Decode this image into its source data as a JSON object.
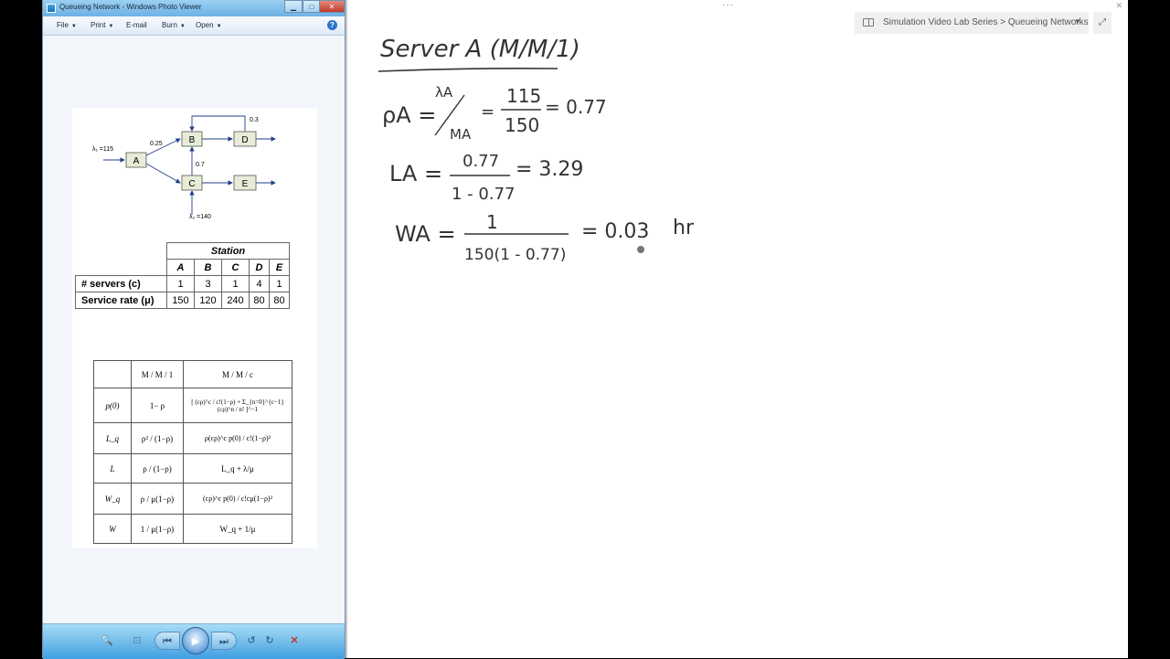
{
  "photo_viewer": {
    "title": "Queueing Network - Windows Photo Viewer",
    "window_controls": {
      "minimize": "▁",
      "maximize": "□",
      "close": "✕"
    },
    "menu": [
      {
        "label": "File"
      },
      {
        "label": "Print"
      },
      {
        "label": "E-mail"
      },
      {
        "label": "Burn"
      },
      {
        "label": "Open"
      }
    ],
    "help": "?",
    "diagram": {
      "nodes": [
        "A",
        "B",
        "C",
        "D",
        "E"
      ],
      "lambda1": "λ₁ =115",
      "lambda2": "λ₂ =140",
      "p_ab": "0.25",
      "p_cb": "0.7",
      "p_db": "0.3"
    },
    "station_table": {
      "title": "Station",
      "stations": [
        "A",
        "B",
        "C",
        "D",
        "E"
      ],
      "rows": [
        {
          "label": "# servers (c)",
          "values": [
            "1",
            "3",
            "1",
            "4",
            "1"
          ]
        },
        {
          "label": "Service rate (μ)",
          "values": [
            "150",
            "120",
            "240",
            "80",
            "80"
          ]
        }
      ]
    },
    "formula_table": {
      "headers": [
        "M / M / 1",
        "M / M / c"
      ],
      "rows": [
        {
          "label": "p(0)",
          "mm1": "1− ρ",
          "mmc": "[ (cρ)^c / c!(1−ρ) + Σ_{n=0}^{c−1} (cρ)^n / n! ]^−1"
        },
        {
          "label": "L_q",
          "mm1": "ρ² / (1−ρ)",
          "mmc": "ρ(cρ)^c p(0) / c!(1−ρ)²"
        },
        {
          "label": "L",
          "mm1": "ρ / (1−ρ)",
          "mmc": "L_q + λ/μ"
        },
        {
          "label": "W_q",
          "mm1": "ρ / μ(1−ρ)",
          "mmc": "(cρ)^c p(0) / c!cμ(1−ρ)²"
        },
        {
          "label": "W",
          "mm1": "1 / μ(1−ρ)",
          "mmc": "W_q + 1/μ"
        }
      ]
    },
    "toolbar": {
      "zoom": "🔍",
      "fit": "⊡",
      "previous": "⏮",
      "slideshow": "▶",
      "next": "⏭",
      "rotate_left": "↺",
      "rotate_right": "↻",
      "delete": "✕"
    }
  },
  "onenote": {
    "dots": "···",
    "close": "✕",
    "breadcrumb": "Simulation Video Lab Series > Queueing Networks",
    "breadcrumb_caret": "▼",
    "expand": "⤢",
    "notes": {
      "heading": "Server A (M/M/1)",
      "rho_lhs": "ρA =",
      "rho_lambda": "λA",
      "rho_mu": "MA",
      "rho_num": "115",
      "rho_den": "150",
      "rho_result": "= 0.77",
      "L_lhs": "LA =",
      "L_num": "0.77",
      "L_den": "1 - 0.77",
      "L_result": "= 3.29",
      "W_lhs": "WA =",
      "W_num": "1",
      "W_den": "150(1 - 0.77)",
      "W_result": "= 0.03",
      "W_unit": "hr"
    }
  }
}
